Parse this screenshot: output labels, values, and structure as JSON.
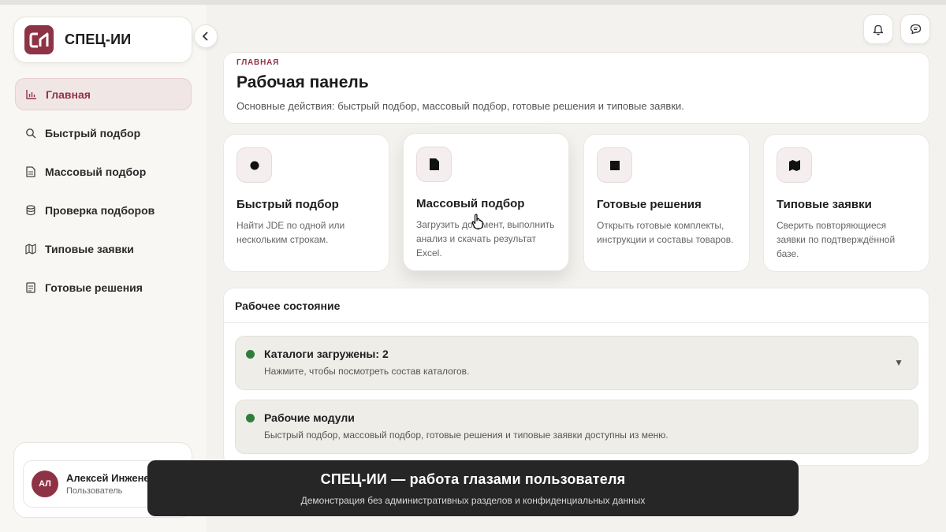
{
  "brand": {
    "logo_text": "СИ",
    "name": "СПЕЦ-ИИ"
  },
  "sidebar": {
    "items": [
      {
        "label": "Главная",
        "icon": "bar-chart-icon",
        "active": true
      },
      {
        "label": "Быстрый подбор",
        "icon": "search-icon"
      },
      {
        "label": "Массовый подбор",
        "icon": "document-icon"
      },
      {
        "label": "Проверка подборов",
        "icon": "database-icon"
      },
      {
        "label": "Типовые заявки",
        "icon": "map-icon"
      },
      {
        "label": "Готовые решения",
        "icon": "list-icon"
      }
    ]
  },
  "user": {
    "initials": "АЛ",
    "name": "Алексей Инженер",
    "role": "Пользователь"
  },
  "header": {
    "breadcrumb": "ГЛАВНАЯ",
    "title": "Рабочая панель",
    "subtitle": "Основные действия: быстрый подбор, массовый подбор, готовые решения и типовые заявки."
  },
  "cards": [
    {
      "title": "Быстрый подбор",
      "desc": "Найти JDE по одной или нескольким строкам.",
      "icon": "circle-icon"
    },
    {
      "title": "Массовый подбор",
      "desc": "Загрузить документ, выполнить анализ и скачать результат Excel.",
      "icon": "file-icon"
    },
    {
      "title": "Готовые решения",
      "desc": "Открыть готовые комплекты, инструкции и составы товаров.",
      "icon": "square-icon"
    },
    {
      "title": "Типовые заявки",
      "desc": "Сверить повторяющиеся заявки по подтверждённой базе.",
      "icon": "map-icon"
    }
  ],
  "status": {
    "title": "Рабочее состояние",
    "rows": [
      {
        "title": "Каталоги загружены: 2",
        "desc": "Нажмите, чтобы посмотреть состав каталогов.",
        "status_color": "#2f7d3a",
        "expandable": true
      },
      {
        "title": "Рабочие модули",
        "desc": "Быстрый подбор, массовый подбор, готовые решения и типовые заявки доступны из меню.",
        "status_color": "#2f7d3a",
        "expandable": false
      }
    ]
  },
  "banner": {
    "title": "СПЕЦ-ИИ — работа глазами пользователя",
    "subtitle": "Демонстрация без административных разделов и конфиденциальных данных"
  },
  "colors": {
    "accent": "#8e3345",
    "status_ok": "#2f7d3a",
    "banner_bg": "#262626"
  }
}
